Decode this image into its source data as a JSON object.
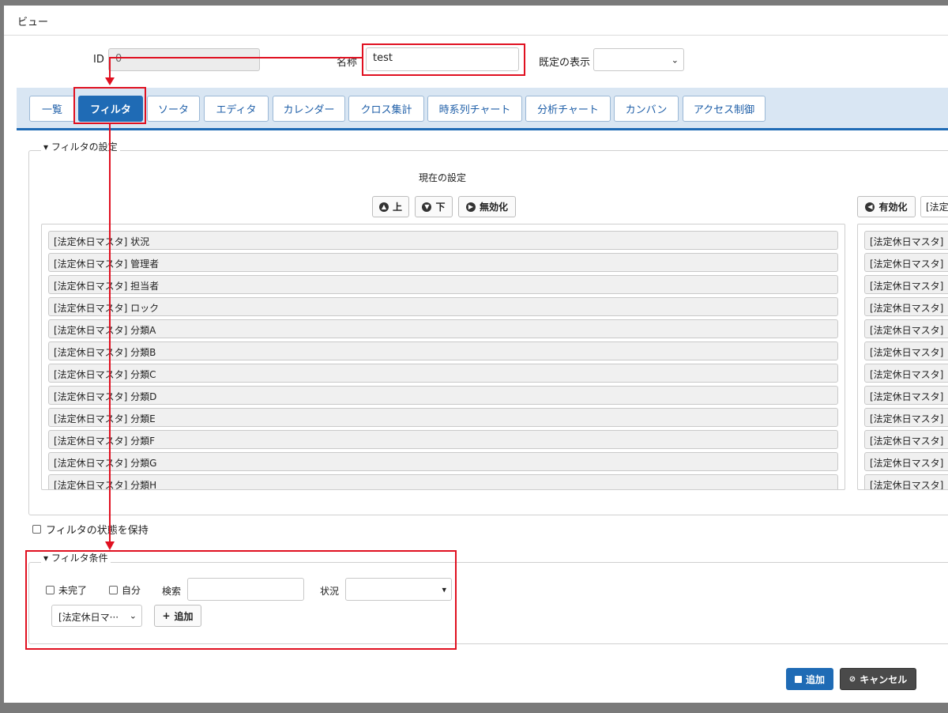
{
  "window": {
    "title": "ビュー"
  },
  "header": {
    "id_label": "ID",
    "id_value": "0",
    "name_label": "名称",
    "name_value": "test",
    "default_view_label": "既定の表示",
    "default_view_value": ""
  },
  "tabs": [
    {
      "label": "一覧"
    },
    {
      "label": "フィルタ"
    },
    {
      "label": "ソータ"
    },
    {
      "label": "エディタ"
    },
    {
      "label": "カレンダー"
    },
    {
      "label": "クロス集計"
    },
    {
      "label": "時系列チャート"
    },
    {
      "label": "分析チャート"
    },
    {
      "label": "カンバン"
    },
    {
      "label": "アクセス制御"
    }
  ],
  "active_tab": "フィルタ",
  "filter_settings": {
    "legend": "フィルタの設定",
    "current_heading": "現在の設定",
    "up_label": "上",
    "down_label": "下",
    "disable_label": "無効化",
    "enable_label": "有効化",
    "right_search_text": "[法定",
    "current_items": [
      "[法定休日マスタ] 状況",
      "[法定休日マスタ] 管理者",
      "[法定休日マスタ] 担当者",
      "[法定休日マスタ] ロック",
      "[法定休日マスタ] 分類A",
      "[法定休日マスタ] 分類B",
      "[法定休日マスタ] 分類C",
      "[法定休日マスタ] 分類D",
      "[法定休日マスタ] 分類E",
      "[法定休日マスタ] 分類F",
      "[法定休日マスタ] 分類G",
      "[法定休日マスタ] 分類H"
    ],
    "available_items": [
      "[法定休日マスタ]",
      "[法定休日マスタ]",
      "[法定休日マスタ]",
      "[法定休日マスタ]",
      "[法定休日マスタ]",
      "[法定休日マスタ]",
      "[法定休日マスタ]",
      "[法定休日マスタ]",
      "[法定休日マスタ]",
      "[法定休日マスタ]",
      "[法定休日マスタ]",
      "[法定休日マスタ]"
    ],
    "keep_state_label": "フィルタの状態を保持"
  },
  "filter_conditions": {
    "legend": "フィルタ条件",
    "incomplete_label": "未完了",
    "self_label": "自分",
    "search_label": "検索",
    "search_value": "",
    "status_label": "状況",
    "status_value": "",
    "column_select_value": "[法定休日マ···",
    "add_label": "追加"
  },
  "footer": {
    "add_label": "追加",
    "cancel_label": "キャンセル"
  },
  "colors": {
    "accent": "#1f6bb5",
    "annotation": "#e01020"
  },
  "icons": [
    "caret-down-icon",
    "up-circle-icon",
    "down-circle-icon",
    "disable-circle-icon",
    "enable-circle-icon",
    "plus-icon",
    "save-icon",
    "cancel-icon"
  ]
}
